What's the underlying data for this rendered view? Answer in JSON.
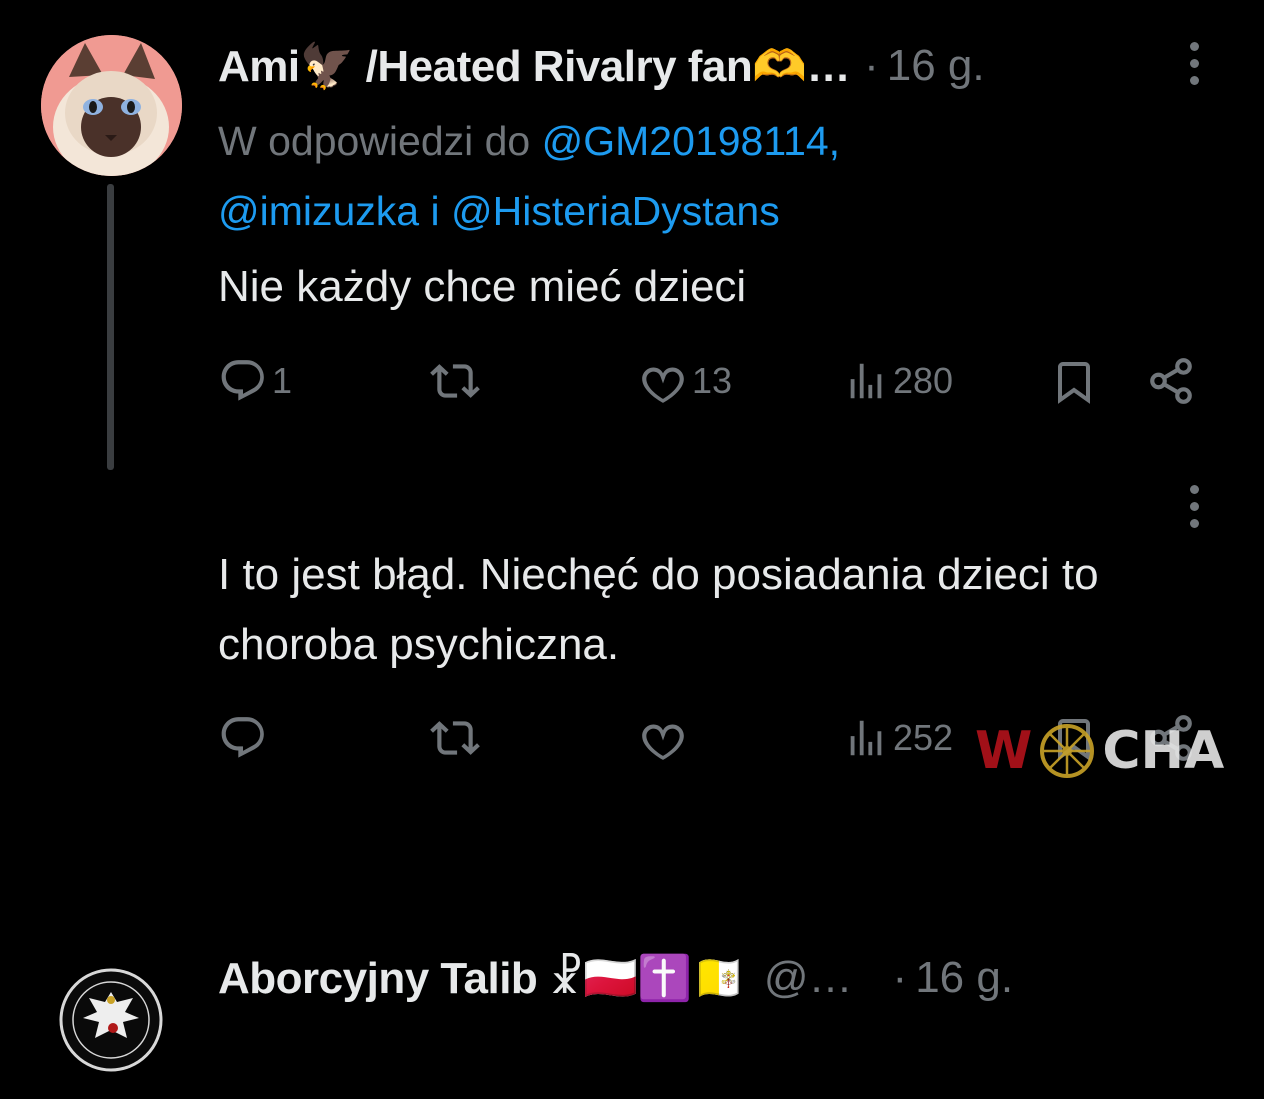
{
  "tweet1": {
    "name": "Ami🦅 /Heated Rivalry fan🫶…",
    "separator": "·",
    "time": "16 g.",
    "reply_prefix": "W odpowiedzi do",
    "mention_1": "@GM20198114,",
    "mention_2": "@imizuzka",
    "reply_joiner": "i",
    "mention_3": "@HisteriaDystans",
    "text": "Nie każdy chce mieć dzieci",
    "replies": "1",
    "reposts": "",
    "likes": "13",
    "views": "280"
  },
  "tweet2": {
    "name": "Aborcyjny Talib ☧🇵🇱✝️🇻🇦",
    "handle": "@…",
    "separator": "·",
    "time": "16 g.",
    "text": "I to jest błąd. Niechęć do posiadania dzieci to choroba psychiczna.",
    "replies": "",
    "reposts": "",
    "likes": "",
    "views": "252"
  },
  "watermark": {
    "part1": "W",
    "part2": "CHA"
  },
  "icons": {
    "reply": "reply-icon",
    "repost": "repost-icon",
    "like": "heart-icon",
    "views": "views-icon",
    "bookmark": "bookmark-icon",
    "share": "share-icon",
    "more": "more-icon"
  },
  "colors": {
    "background": "#000000",
    "text": "#e7e9ea",
    "muted": "#71767b",
    "link": "#1d9bf0",
    "thread_line": "#3a3d40"
  }
}
